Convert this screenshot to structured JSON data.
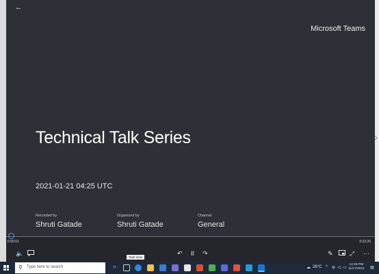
{
  "video": {
    "back_icon": "←",
    "brand": "Microsoft Teams",
    "title": "Technical Talk Series",
    "datetime": "2021-01-21 04:25 UTC",
    "recorded_by_label": "Recorded by",
    "recorded_by_value": "Shruti Gatade",
    "organized_by_label": "Organized by",
    "organized_by_value": "Shruti Gatade",
    "channel_label": "Channel",
    "channel_value": "General",
    "next_icon": "›"
  },
  "player": {
    "current_time": "0:00:01",
    "total_time": "0:32:26",
    "volume_icon": "🔈",
    "captions_icon": "caption-icon",
    "rewind_icon": "↶",
    "pause_icon": "II",
    "forward_icon": "↷",
    "tooltip": "Task View",
    "edit_icon": "✎",
    "pip_icon": "picture-in-picture-icon",
    "fullscreen_icon": "⤢",
    "more_icon": "···",
    "accent_color": "#4f9be8"
  },
  "taskbar": {
    "search_placeholder": "Type here to search",
    "search_icon": "⚲",
    "cortana_icon": "○",
    "weather": "26°C",
    "tray_chevron": "^",
    "time": "12:25 PM",
    "date": "11/17/2021"
  }
}
